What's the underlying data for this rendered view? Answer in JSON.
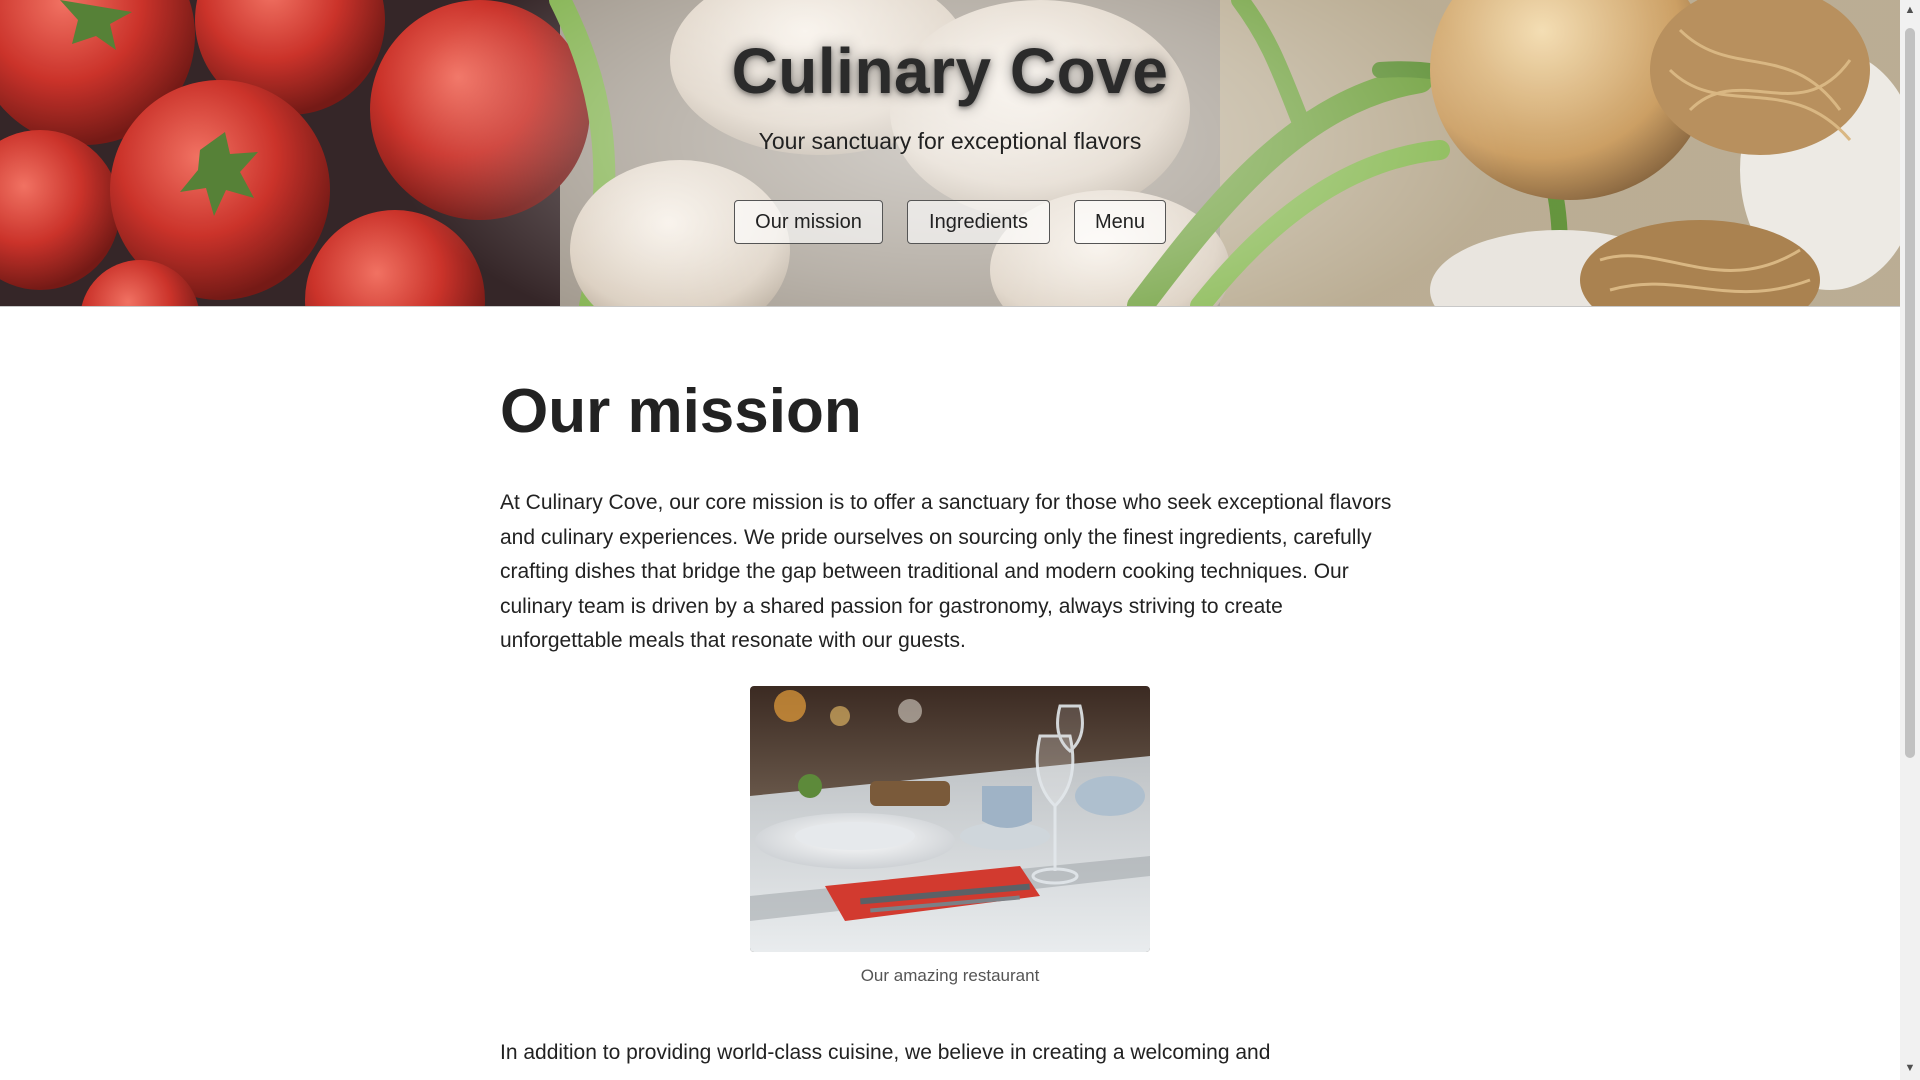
{
  "site": {
    "title": "Culinary Cove",
    "tagline": "Your sanctuary for exceptional flavors"
  },
  "nav": {
    "items": [
      {
        "label": "Our mission"
      },
      {
        "label": "Ingredients"
      },
      {
        "label": "Menu"
      }
    ]
  },
  "main": {
    "heading": "Our mission",
    "mission_paragraph": "At Culinary Cove, our core mission is to offer a sanctuary for those who seek exceptional flavors and culinary experiences. We pride ourselves on sourcing only the finest ingredients, carefully crafting dishes that bridge the gap between traditional and modern cooking techniques. Our culinary team is driven by a shared passion for gastronomy, always striving to create unforgettable meals that resonate with our guests.",
    "figure": {
      "caption": "Our amazing restaurant"
    },
    "second_paragraph": "In addition to providing world-class cuisine, we believe in creating a welcoming and"
  },
  "icons": {
    "scroll_up": "triangle-up-icon",
    "scroll_down": "triangle-down-icon"
  },
  "colors": {
    "text": "#222222",
    "caption": "#555555",
    "button_border": "#555555",
    "scrollbar_thumb": "#c1c1c1"
  }
}
